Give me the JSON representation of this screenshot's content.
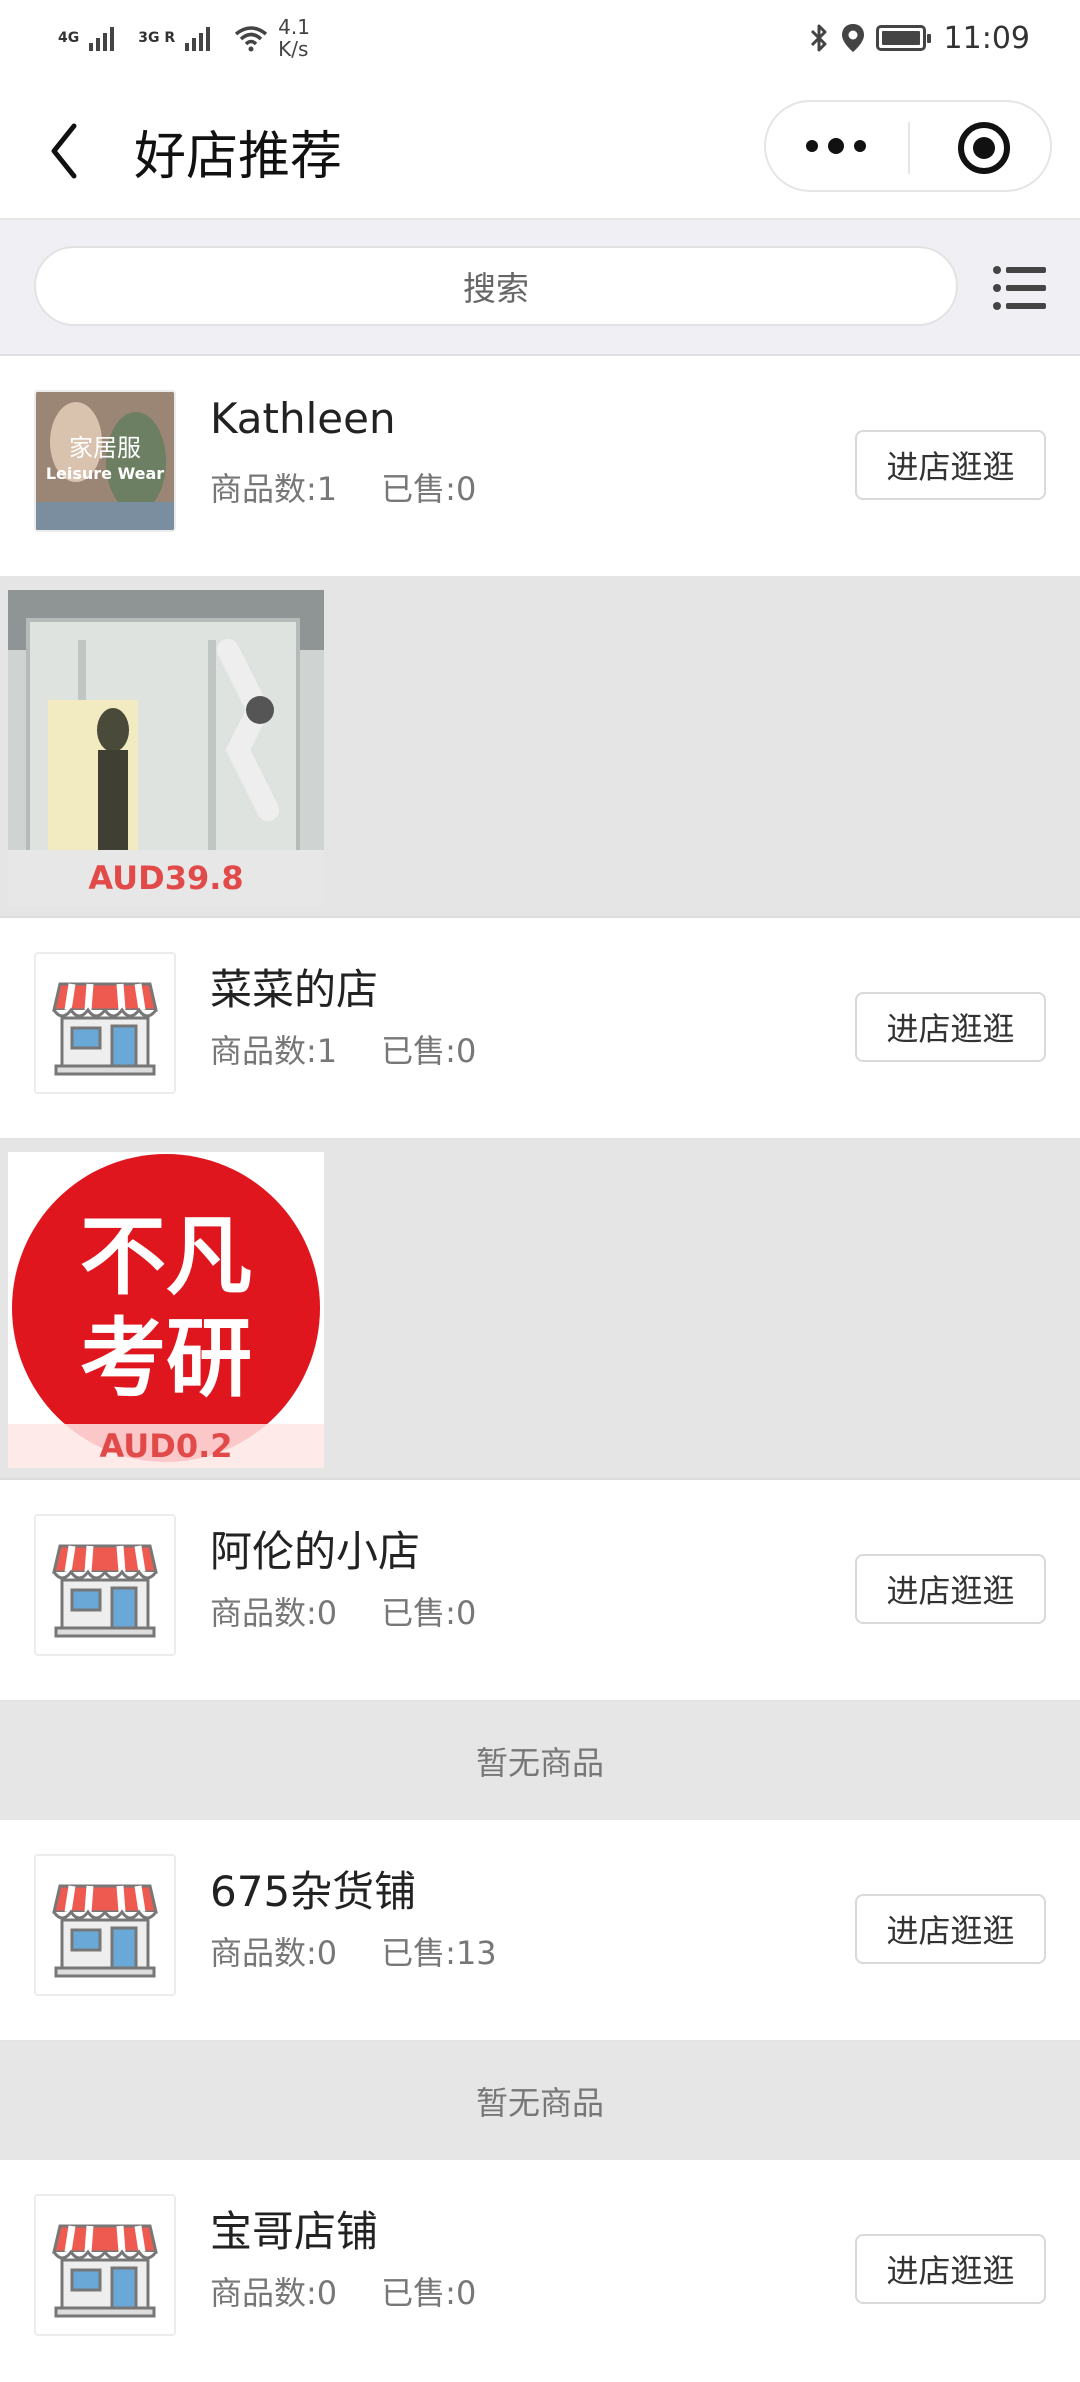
{
  "status_bar": {
    "net1": "4G",
    "net2": "3G R",
    "speed_value": "4.1",
    "speed_unit": "K/s",
    "time": "11:09",
    "icons": [
      "signal-icon",
      "wifi-icon",
      "bluetooth-icon",
      "location-icon",
      "battery-icon"
    ]
  },
  "nav": {
    "title": "好店推荐",
    "icons": [
      "back-arrow-icon",
      "more-dots-icon",
      "target-icon"
    ]
  },
  "search": {
    "placeholder": "搜索",
    "menu_icon": "list-menu-icon"
  },
  "shops": [
    {
      "name": "Kathleen",
      "count_label": "商品数:1",
      "sold_label": "已售:0",
      "button": "进店逛逛",
      "logo": {
        "title": "家居服",
        "subtitle": "Leisure Wear"
      },
      "product": {
        "price": "AUD39.8",
        "image": "robot-arm-store-photo"
      }
    },
    {
      "name": "菜菜的店",
      "count_label": "商品数:1",
      "sold_label": "已售:0",
      "button": "进店逛逛",
      "logo": {
        "icon": "storefront-icon"
      },
      "product": {
        "price": "AUD0.2",
        "image_line1": "不凡",
        "image_line2": "考研"
      }
    },
    {
      "name": "阿伦的小店",
      "count_label": "商品数:0",
      "sold_label": "已售:0",
      "button": "进店逛逛",
      "logo": {
        "icon": "storefront-icon"
      },
      "empty_text": "暂无商品"
    },
    {
      "name": "675杂货铺",
      "count_label": "商品数:0",
      "sold_label": "已售:13",
      "button": "进店逛逛",
      "logo": {
        "icon": "storefront-icon"
      },
      "empty_text": "暂无商品"
    },
    {
      "name": "宝哥店铺",
      "count_label": "商品数:0",
      "sold_label": "已售:0",
      "button": "进店逛逛",
      "logo": {
        "icon": "storefront-icon"
      }
    }
  ],
  "colors": {
    "price": "#e24a4a",
    "awning_red": "#ef5a50",
    "door_blue": "#6aa8d8",
    "poster_red": "#e0161e"
  }
}
